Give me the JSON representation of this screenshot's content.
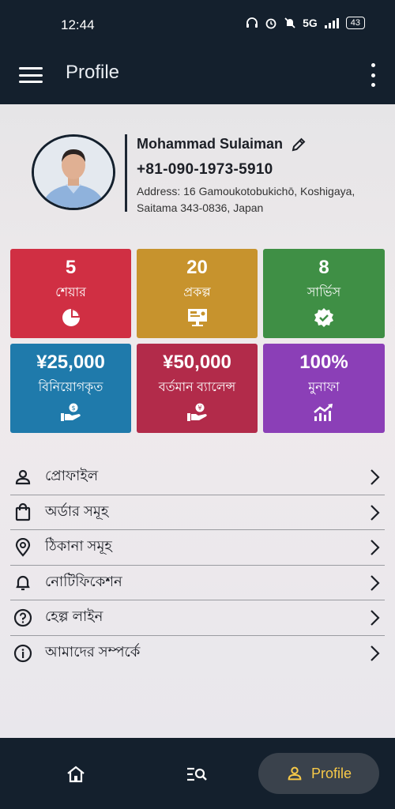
{
  "status": {
    "time": "12:44",
    "network": "5G",
    "battery": "43"
  },
  "appbar": {
    "title": "Profile"
  },
  "profile": {
    "name": "Mohammad Sulaiman",
    "phone": "+81-090-1973-5910",
    "address": "Address: 16 Gamoukotobukichō, Koshigaya, Saitama 343-0836, Japan"
  },
  "tiles": [
    {
      "value": "5",
      "label": "শেয়ার",
      "icon": "pie-chart-icon",
      "color": "#d02f43"
    },
    {
      "value": "20",
      "label": "প্রকল্প",
      "icon": "presentation-icon",
      "color": "#c7932d"
    },
    {
      "value": "8",
      "label": "সার্ভিস",
      "icon": "verified-badge-icon",
      "color": "#3f8f45"
    },
    {
      "value": "¥25,000",
      "label": "বিনিয়োগকৃত",
      "icon": "hand-coin-icon",
      "color": "#1f7aab"
    },
    {
      "value": "¥50,000",
      "label": "বর্তমান ব্যালেন্স",
      "icon": "hand-coin-icon",
      "color": "#b22b4a"
    },
    {
      "value": "100%",
      "label": "মুনাফা",
      "icon": "trending-up-icon",
      "color": "#8b3fb7"
    }
  ],
  "menu": [
    {
      "label": "প্রোফাইল",
      "icon": "person-icon"
    },
    {
      "label": "অর্ডার সমূহ",
      "icon": "shopping-bag-icon"
    },
    {
      "label": "ঠিকানা সমূহ",
      "icon": "location-pin-icon"
    },
    {
      "label": "নোটিফিকেশন",
      "icon": "bell-icon"
    },
    {
      "label": "হেল্প লাইন",
      "icon": "help-circle-icon"
    },
    {
      "label": "আমাদের সম্পর্কে",
      "icon": "info-icon"
    }
  ],
  "bottomnav": {
    "active_label": "Profile"
  },
  "colors": {
    "header": "#14202d",
    "active_nav": "#f7c948"
  }
}
